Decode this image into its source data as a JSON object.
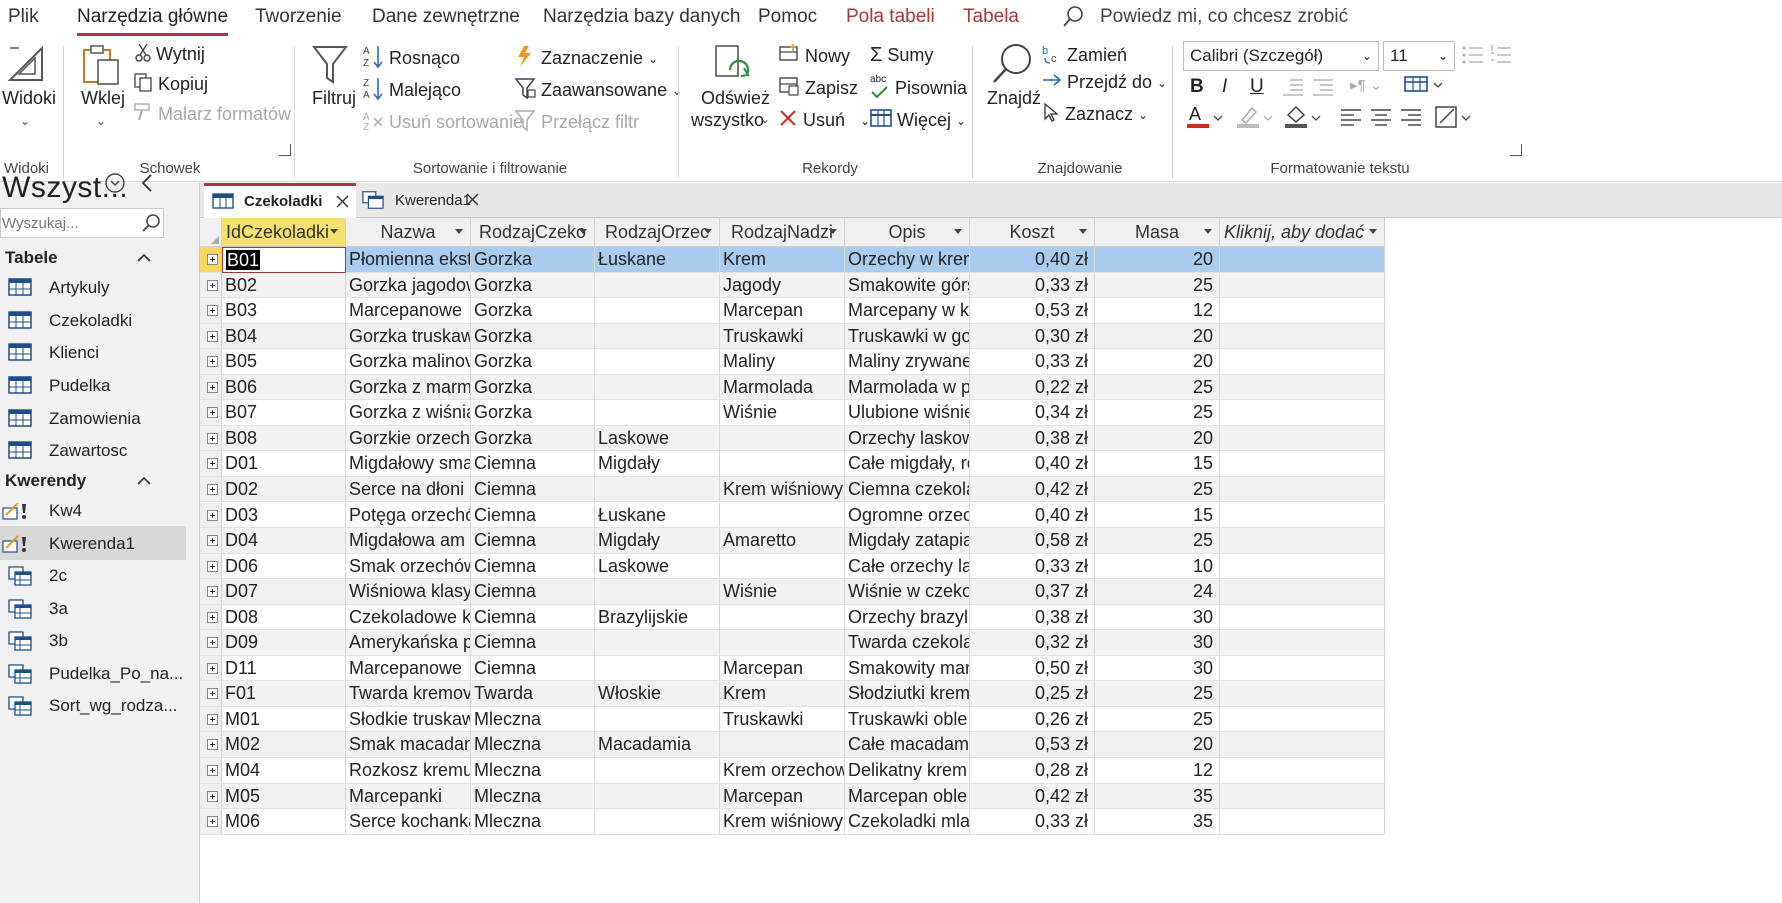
{
  "menu": {
    "tabs": [
      "Plik",
      "Narzędzia główne",
      "Tworzenie",
      "Dane zewnętrzne",
      "Narzędzia bazy danych",
      "Pomoc",
      "Pola tabeli",
      "Tabela"
    ],
    "active_tab": "Narzędzia główne",
    "tell_me": "Powiedz mi, co chcesz zrobić"
  },
  "ribbon": {
    "views": {
      "label": "Widoki",
      "big": "Widoki"
    },
    "clipboard": {
      "label": "Schowek",
      "paste": "Wklej",
      "cut": "Wytnij",
      "copy": "Kopiuj",
      "painter": "Malarz formatów"
    },
    "sort": {
      "label": "Sortowanie i filtrowanie",
      "filter": "Filtruj",
      "asc": "Rosnąco",
      "desc": "Malejąco",
      "remove_sort": "Usuń sortowanie",
      "selection": "Zaznaczenie",
      "advanced": "Zaawansowane",
      "toggle": "Przełącz filtr"
    },
    "records": {
      "label": "Rekordy",
      "refresh1": "Odśwież",
      "refresh2": "wszystko",
      "new": "Nowy",
      "save": "Zapisz",
      "delete": "Usuń",
      "totals": "Sumy",
      "spelling": "Pisownia",
      "more": "Więcej",
      "abc": "abc"
    },
    "find": {
      "label": "Znajdowanie",
      "find": "Znajdź",
      "replace": "Zamień",
      "goto": "Przejdź do",
      "select": "Zaznacz"
    },
    "format": {
      "label": "Formatowanie tekstu",
      "font": "Calibri (Szczegół)",
      "size": "11",
      "bold": "B",
      "italic": "I",
      "underline": "U"
    }
  },
  "nav": {
    "title": "Wszyst...",
    "search_placeholder": "Wyszukaj...",
    "groups": [
      {
        "name": "Tabele",
        "items": [
          "Artykuly",
          "Czekoladki",
          "Klienci",
          "Pudelka",
          "Zamowienia",
          "Zawartosc"
        ]
      },
      {
        "name": "Kwerendy",
        "items": [
          "Kw4",
          "Kwerenda1",
          "2c",
          "3a",
          "3b",
          "Pudelka_Po_na...",
          "Sort_wg_rodza..."
        ]
      }
    ],
    "selected": "Kwerenda1"
  },
  "doc_tabs": [
    {
      "label": "Czekoladki",
      "active": true
    },
    {
      "label": "Kwerenda1",
      "active": false
    }
  ],
  "table": {
    "columns": [
      "IdCzekoladki",
      "Nazwa",
      "RodzajCzeko",
      "RodzajOrzec",
      "RodzajNadzi",
      "Opis",
      "Koszt",
      "Masa",
      "Kliknij, aby dodać"
    ],
    "rows": [
      [
        "B01",
        "Płomienna ekst",
        "Gorzka",
        "Łuskane",
        "Krem",
        "Orzechy w krem",
        "0,40 zł",
        "20"
      ],
      [
        "B02",
        "Gorzka jagodow",
        "Gorzka",
        "",
        "Jagody",
        "Smakowite górs",
        "0,33 zł",
        "25"
      ],
      [
        "B03",
        "Marcepanowe",
        "Gorzka",
        "",
        "Marcepan",
        "Marcepany w k",
        "0,53 zł",
        "12"
      ],
      [
        "B04",
        "Gorzka truskaw",
        "Gorzka",
        "",
        "Truskawki",
        "Truskawki w go",
        "0,30 zł",
        "20"
      ],
      [
        "B05",
        "Gorzka malinov",
        "Gorzka",
        "",
        "Maliny",
        "Maliny zrywane",
        "0,33 zł",
        "20"
      ],
      [
        "B06",
        "Gorzka z marm",
        "Gorzka",
        "",
        "Marmolada",
        "Marmolada w p",
        "0,22 zł",
        "25"
      ],
      [
        "B07",
        "Gorzka z wiśnia",
        "Gorzka",
        "",
        "Wiśnie",
        "Ulubione wiśnie",
        "0,34 zł",
        "25"
      ],
      [
        "B08",
        "Gorzkie orzechy",
        "Gorzka",
        "Laskowe",
        "",
        "Orzechy laskow",
        "0,38 zł",
        "20"
      ],
      [
        "D01",
        "Migdałowy sma",
        "Ciemna",
        "Migdały",
        "",
        "Całe migdały, re",
        "0,40 zł",
        "15"
      ],
      [
        "D02",
        "Serce na dłoni",
        "Ciemna",
        "",
        "Krem wiśniowy",
        "Ciemna czekola",
        "0,42 zł",
        "25"
      ],
      [
        "D03",
        "Potęga orzechó",
        "Ciemna",
        "Łuskane",
        "",
        "Ogromne orzec",
        "0,40 zł",
        "15"
      ],
      [
        "D04",
        "Migdałowa am",
        "Ciemna",
        "Migdały",
        "Amaretto",
        "Migdały zatapia",
        "0,58 zł",
        "25"
      ],
      [
        "D06",
        "Smak orzechów",
        "Ciemna",
        "Laskowe",
        "",
        "Całe orzechy la",
        "0,33 zł",
        "10"
      ],
      [
        "D07",
        "Wiśniowa klasy",
        "Ciemna",
        "",
        "Wiśnie",
        "Wiśnie w czeko",
        "0,37 zł",
        "24"
      ],
      [
        "D08",
        "Czekoladowe k",
        "Ciemna",
        "Brazylijskie",
        "",
        "Orzechy brazyli",
        "0,38 zł",
        "30"
      ],
      [
        "D09",
        "Amerykańska p",
        "Ciemna",
        "",
        "",
        "Twarda czekola",
        "0,32 zł",
        "30"
      ],
      [
        "D11",
        "Marcepanowe",
        "Ciemna",
        "",
        "Marcepan",
        "Smakowity mar",
        "0,50 zł",
        "30"
      ],
      [
        "F01",
        "Twarda kremov",
        "Twarda",
        "Włoskie",
        "Krem",
        "Słodziutki krem",
        "0,25 zł",
        "25"
      ],
      [
        "M01",
        "Słodkie truskaw",
        "Mleczna",
        "",
        "Truskawki",
        "Truskawki oble",
        "0,26 zł",
        "25"
      ],
      [
        "M02",
        "Smak macadam",
        "Mleczna",
        "Macadamia",
        "",
        "Całe macadami",
        "0,53 zł",
        "20"
      ],
      [
        "M04",
        "Rozkosz kremu",
        "Mleczna",
        "",
        "Krem orzechow",
        "Delikatny krem",
        "0,28 zł",
        "12"
      ],
      [
        "M05",
        "Marcepanki",
        "Mleczna",
        "",
        "Marcepan",
        "Marcepan oble",
        "0,42 zł",
        "35"
      ],
      [
        "M06",
        "Serce kochanka",
        "Mleczna",
        "",
        "Krem wiśniowy",
        "Czekoladki mla",
        "0,33 zł",
        "35"
      ]
    ]
  },
  "colors": {
    "accent": "#a4373a",
    "key_header": "#f5e06e",
    "selected_row": "#a8cdf0",
    "row_alt": "#f2f2f2"
  }
}
